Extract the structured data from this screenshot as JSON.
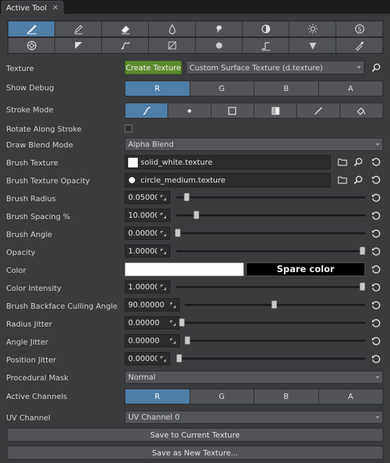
{
  "tab": {
    "title": "Active Tool",
    "close": "×"
  },
  "tools_row1": [
    "brush-icon",
    "pencil-icon",
    "eraser-icon",
    "drop-icon",
    "smudge-icon",
    "contrast-icon",
    "brightness-icon",
    "saturation-icon"
  ],
  "tools_row2": [
    "clone-icon",
    "fill-icon",
    "curve-icon",
    "gradient-icon",
    "sphere-icon",
    "step-icon",
    "cone-icon",
    "eyedropper-icon"
  ],
  "texture": {
    "label": "Texture",
    "create_button": "Create Texture",
    "value": "Custom Surface Texture (d.texture)"
  },
  "show_debug": {
    "label": "Show Debug",
    "options": [
      "R",
      "G",
      "B",
      "A"
    ],
    "active": "R"
  },
  "stroke_mode": {
    "label": "Stroke Mode",
    "active": 0
  },
  "rotate_along_stroke": {
    "label": "Rotate Along Stroke",
    "checked": false
  },
  "draw_blend_mode": {
    "label": "Draw Blend Mode",
    "value": "Alpha Blend"
  },
  "brush_texture": {
    "label": "Brush Texture",
    "value": "solid_white.texture"
  },
  "brush_texture_opacity": {
    "label": "Brush Texture Opacity",
    "value": "circle_medium.texture"
  },
  "sliders": [
    {
      "label": "Brush Radius",
      "value": "0.05000",
      "fraction": 0.05
    },
    {
      "label": "Brush Spacing %",
      "value": "10.00000",
      "fraction": 0.1
    },
    {
      "label": "Brush Angle",
      "value": "0.00000",
      "fraction": 0.0
    },
    {
      "label": "Opacity",
      "value": "1.00000",
      "fraction": 1.0
    }
  ],
  "color": {
    "label": "Color",
    "primary": "#ffffff",
    "spare_label": "Spare color",
    "spare": "#000000"
  },
  "color_intensity": {
    "label": "Color Intensity",
    "value": "1.00000",
    "fraction": 1.0
  },
  "backface": {
    "label": "Brush Backface Culling Angle",
    "value": "90.00000",
    "fraction": 0.5
  },
  "jitters": [
    {
      "label": "Radius Jitter",
      "value": "0.00000",
      "fraction": 0.0
    },
    {
      "label": "Angle Jitter",
      "value": "0.00000",
      "fraction": 0.0
    },
    {
      "label": "Position Jitter",
      "value": "0.00000",
      "fraction": 0.0
    }
  ],
  "procedural_mask": {
    "label": "Procedural Mask",
    "value": "Normal"
  },
  "active_channels": {
    "label": "Active Channels",
    "options": [
      "R",
      "G",
      "B",
      "A"
    ],
    "active": "R"
  },
  "uv_channel": {
    "label": "UV Channel",
    "value": "UV Channel 0"
  },
  "buttons": {
    "save_current": "Save to Current Texture",
    "save_new": "Save as New Texture..."
  },
  "colors": {
    "accent": "#4f7ea6",
    "create": "#5c8a2c"
  }
}
